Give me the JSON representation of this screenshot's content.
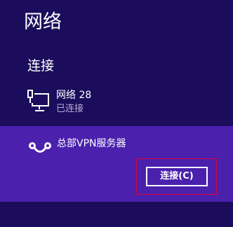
{
  "panel": {
    "title": "网络"
  },
  "connections": {
    "heading": "连接"
  },
  "wired_network": {
    "icon": "wired-network-icon",
    "name": "网络  28",
    "status": "已连接"
  },
  "vpn": {
    "icon": "vpn-icon",
    "name": "总部VPN服务器",
    "connect_label": "连接(C)"
  },
  "colors": {
    "background": "#1b0d5c",
    "selected_item": "#4a20ad",
    "status_text": "#b7add8",
    "highlight_outline": "#e0003c"
  }
}
